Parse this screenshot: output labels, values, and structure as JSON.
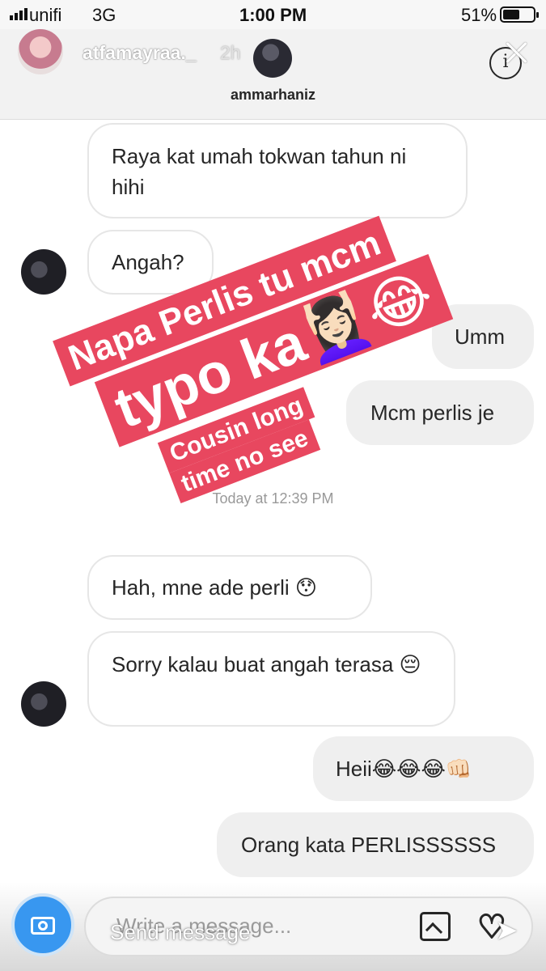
{
  "status_bar": {
    "carrier": "unifi",
    "network": "3G",
    "time": "1:00 PM",
    "battery": "51%"
  },
  "story": {
    "username": "atfamayraa._",
    "age": "2h"
  },
  "thread": {
    "username": "ammarhaniz"
  },
  "messages": [
    {
      "text": "Raya kat umah tokwan tahun ni hihi",
      "from": "them"
    },
    {
      "text": "Angah?",
      "from": "them"
    },
    {
      "text": "Umm",
      "from": "me"
    },
    {
      "text": "Mcm perlis je",
      "from": "me"
    },
    {
      "text": "Hah, mne ade perli 😯",
      "from": "them"
    },
    {
      "text": "Sorry kalau buat angah terasa 😔",
      "from": "them"
    },
    {
      "text": "Heii😂😂😂👊🏻",
      "from": "me"
    },
    {
      "text": "Orang kata PERLISSSSSS",
      "from": "me"
    }
  ],
  "timestamp": "Today at 12:39 PM",
  "sticker": {
    "line1": "Napa Perlis tu mcm",
    "line2": "typo ka💆🏻‍♀️😂",
    "line3": "Cousin long",
    "line4": "time no see"
  },
  "composer": {
    "placeholder": "Write a message...",
    "send_label": "Send message"
  },
  "colors": {
    "sticker": "#e8475f",
    "camera": "#3897f0",
    "outgoing_bubble": "#efefef"
  },
  "icons": [
    "camera-icon",
    "gallery-icon",
    "heart-icon",
    "share-icon",
    "info-icon",
    "close-icon"
  ]
}
